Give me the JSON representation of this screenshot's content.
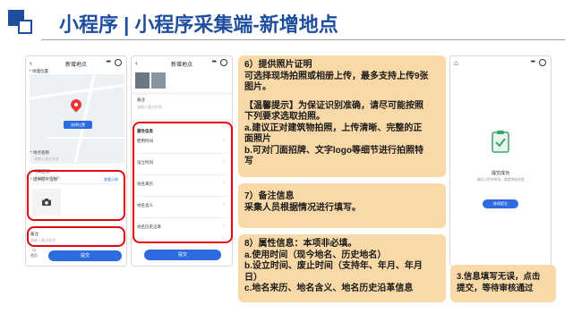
{
  "header": {
    "title": "小程序 | 小程序采集端-新增地点"
  },
  "phone1": {
    "title": "新增地点",
    "map_button": "选择位置",
    "fields": [
      {
        "label": "* 地理位置",
        "placeholder": ""
      },
      {
        "label": "* 行政区划",
        "placeholder": "请选择行政区划"
      },
      {
        "label": "* 地点名称",
        "placeholder": "请输入地点名称"
      },
      {
        "label": "* 提供照片证明",
        "placeholder": "查看示例"
      }
    ],
    "note_label": "备注",
    "note_placeholder": "请输入备注信息",
    "home_label": "首页",
    "submit": "提交"
  },
  "phone2": {
    "title": "新增地点",
    "note_label": "备注",
    "note_placeholder": "请输入备注信息",
    "attr_title": "属性信息",
    "attrs": [
      "使用时间",
      "设立时间",
      "地名来历",
      "地名含义",
      "地名历史沿革"
    ],
    "submit": "提交"
  },
  "phone3": {
    "success_title": "提交成功",
    "success_desc": "请耐心等待审核，查看审核进度",
    "button": "继续提交"
  },
  "box6": {
    "lines": [
      "6）提供照片证明",
      "可选择现场拍照或相册上传，最多支持上传9张",
      "图片。",
      "【温馨提示】为保证识别准确，请尽可能按照",
      "下列要求选取拍照。",
      "a.建议正对建筑物拍照，上传清晰、完整的正",
      "面照片",
      "b.可对门面招牌、文字logo等细节进行拍照特",
      "写"
    ]
  },
  "box7": {
    "lines": [
      "7）备注信息",
      "采集人员根据情况进行填写。"
    ]
  },
  "box8": {
    "lines": [
      "8）属性信息：本项非必填。",
      "a.使用时间（现今地名、历史地名）",
      "b.设立时间、废止时间（支持年、年月、年月",
      "日）",
      "c.地名来历、地名含义、地名历史沿革信息"
    ]
  },
  "box3": {
    "lines": [
      "3.信息填写无误，点击",
      "提交，等待审核通过"
    ]
  },
  "colors": {
    "brand": "#1f4e9e",
    "accent": "#2c6be0",
    "highlight": "#e60012",
    "box": "#fad9a8"
  }
}
